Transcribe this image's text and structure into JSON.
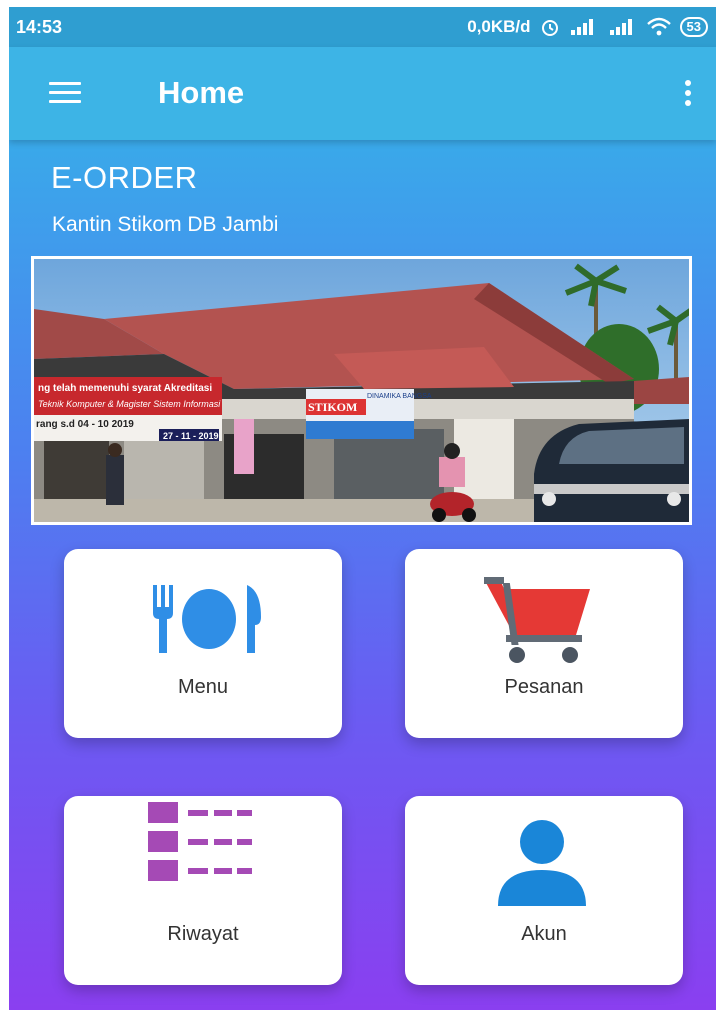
{
  "status_bar": {
    "time": "14:53",
    "speed": "0,0KB/d",
    "battery": "53"
  },
  "app_bar": {
    "title": "Home"
  },
  "header": {
    "brand": "E-ORDER",
    "subtitle": "Kantin Stikom DB Jambi"
  },
  "photo_text": {
    "banner_left_line1": "ng telah memenuhi syarat Akreditasi",
    "banner_left_line2": "Teknik Komputer & Magister Sistem Informasi",
    "banner_date_left": "rang s.d 04 - 10 2019",
    "banner_date_right": "27 - 11 - 2019",
    "banner_center": "STIKOM",
    "banner_center_sub": "DINAMIKA BANGSA"
  },
  "menu_cards": [
    {
      "label": "Menu",
      "icon": "utensils-icon",
      "color": "#2f8ee6"
    },
    {
      "label": "Pesanan",
      "icon": "cart-icon",
      "color": "#e53935"
    },
    {
      "label": "Riwayat",
      "icon": "list-icon",
      "color": "#a54ab5"
    },
    {
      "label": "Akun",
      "icon": "user-icon",
      "color": "#1a86d8"
    }
  ],
  "colors": {
    "app_bar": "#3db4e6",
    "status_bar": "#2f9ed1",
    "gradient_bottom": "#8a3ff0"
  }
}
